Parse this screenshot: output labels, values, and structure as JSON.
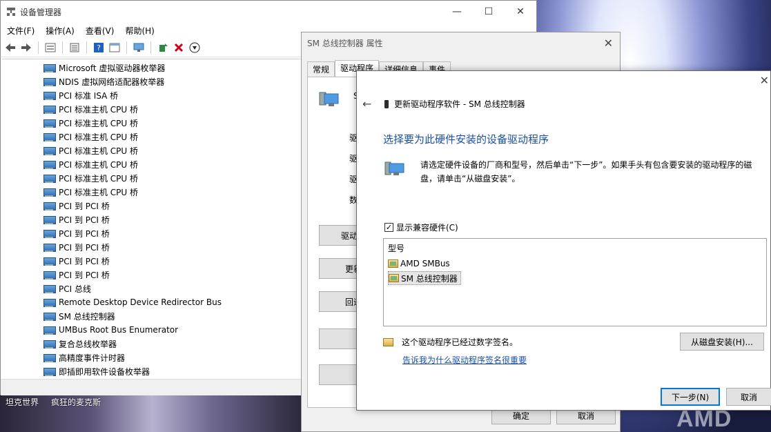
{
  "desktop": {
    "icons": [
      "坦克世界",
      "疯狂的麦克斯"
    ],
    "logo_text": "AMD"
  },
  "device_manager": {
    "title": "设备管理器",
    "menu": [
      "文件(F)",
      "操作(A)",
      "查看(V)",
      "帮助(H)"
    ],
    "devices": [
      "Microsoft 虚拟驱动器枚举器",
      "NDIS 虚拟网络适配器枚举器",
      "PCI 标准 ISA 桥",
      "PCI 标准主机 CPU 桥",
      "PCI 标准主机 CPU 桥",
      "PCI 标准主机 CPU 桥",
      "PCI 标准主机 CPU 桥",
      "PCI 标准主机 CPU 桥",
      "PCI 标准主机 CPU 桥",
      "PCI 标准主机 CPU 桥",
      "PCI 到 PCI 桥",
      "PCI 到 PCI 桥",
      "PCI 到 PCI 桥",
      "PCI 到 PCI 桥",
      "PCI 到 PCI 桥",
      "PCI 到 PCI 桥",
      "PCI 总线",
      "Remote Desktop Device Redirector Bus",
      "SM 总线控制器",
      "UMBus Root Bus Enumerator",
      "复合总线枚举器",
      "高精度事件计时器",
      "即插即用软件设备枚举器"
    ]
  },
  "properties": {
    "title": "SM 总线控制器 属性",
    "tabs": [
      "常规",
      "驱动程序",
      "详细信息",
      "事件"
    ],
    "partial_labels": [
      "驱",
      "驱",
      "驱",
      "数"
    ],
    "partial_buttons": [
      "驱动程",
      "更新",
      "回退",
      "",
      ""
    ],
    "ok": "确定",
    "cancel": "取消",
    "partial_device_letter": "S"
  },
  "update_driver": {
    "header": "更新驱动程序软件 - SM 总线控制器",
    "heading": "选择要为此硬件安装的设备驱动程序",
    "description": "请选定硬件设备的厂商和型号，然后单击“下一步”。如果手头有包含要安装的驱动程序的磁盘，请单击“从磁盘安装”。",
    "show_compatible": "显示兼容硬件(C)",
    "list_header": "型号",
    "models": [
      "AMD SMBus",
      "SM 总线控制器"
    ],
    "signed_text": "这个驱动程序已经过数字签名。",
    "link": "告诉我为什么驱动程序签名很重要",
    "have_disk": "从磁盘安装(H)...",
    "next": "下一步(N)",
    "cancel": "取消"
  }
}
